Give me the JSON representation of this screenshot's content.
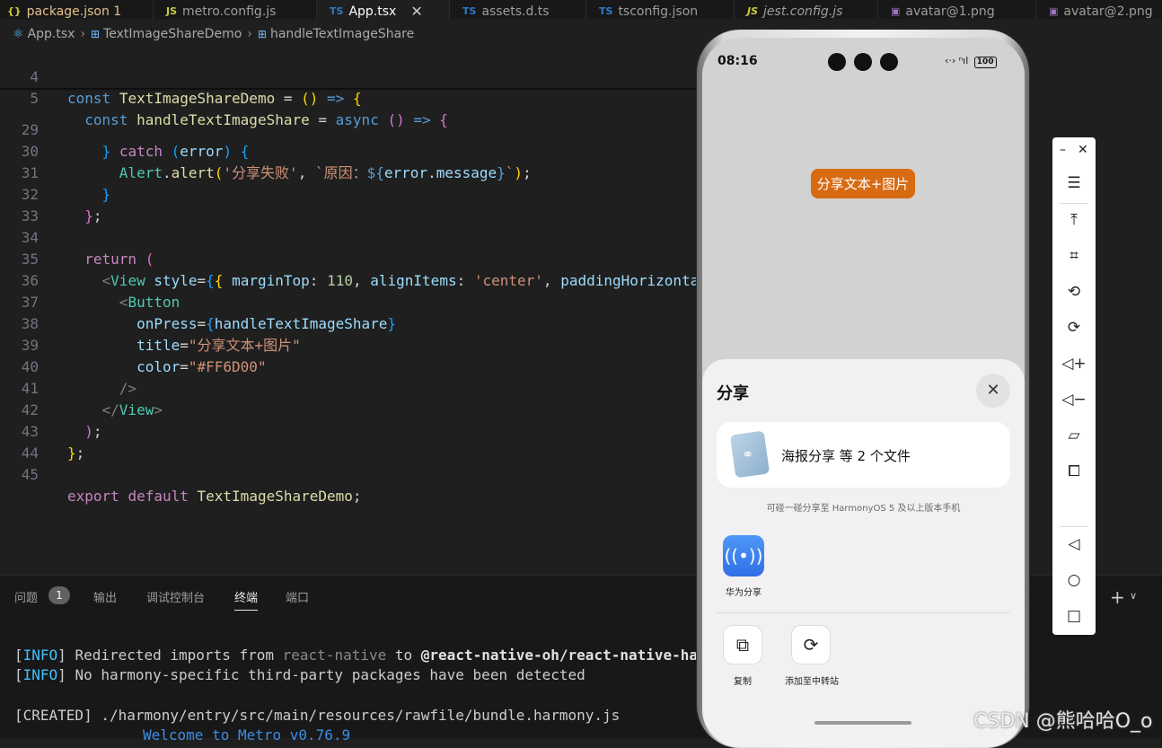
{
  "editor": {
    "tabs": [
      {
        "label": "package.json 1",
        "icon": "{}"
      },
      {
        "label": "metro.config.js",
        "icon": "JS"
      },
      {
        "label": "App.tsx",
        "icon": "TS"
      },
      {
        "label": "assets.d.ts",
        "icon": "TS"
      },
      {
        "label": "tsconfig.json",
        "icon": "TS"
      },
      {
        "label": "jest.config.js",
        "icon": "JS"
      },
      {
        "label": "avatar@1.png",
        "icon": "img"
      },
      {
        "label": "avatar@2.png",
        "icon": "img"
      }
    ],
    "breadcrumb": [
      "App.tsx",
      "TextImageShareDemo",
      "handleTextImageShare"
    ],
    "line_numbers": [
      "4",
      "5",
      "29",
      "30",
      "31",
      "32",
      "33",
      "34",
      "35",
      "36",
      "37",
      "38",
      "39",
      "40",
      "41",
      "42",
      "43",
      "44",
      "45"
    ]
  },
  "panel": {
    "tabs": [
      "问题",
      "输出",
      "调试控制台",
      "终端",
      "端口"
    ],
    "problems_count": "1",
    "terminal": {
      "info_tag": "INFO",
      "line1_text": "Redirected imports from",
      "line1_pkg_from": "react-native",
      "line1_to": "to",
      "line1_pkg_to": "@react-native-oh/react-native-harmony",
      "line2_text": "No harmony-specific third-party packages have been detected",
      "line3": "[CREATED] ./harmony/entry/src/main/resources/rawfile/bundle.harmony.js",
      "line4": "Welcome to Metro v0.76.9"
    }
  },
  "phone": {
    "time": "08:16",
    "battery": "100",
    "app_button_label": "分享文本+图片",
    "sheet": {
      "title": "分享",
      "file_label": "海报分享 等 2 个文件",
      "hint": "可碰一碰分享至 HarmonyOS 5 及以上版本手机",
      "huawei_share": "华为分享",
      "actions": [
        "复制",
        "添加至中转站"
      ]
    }
  },
  "watermark": "CSDN @熊哈哈O_o",
  "colors": {
    "button": "#FF6D00",
    "huawei_share": "#2F6FE6"
  }
}
